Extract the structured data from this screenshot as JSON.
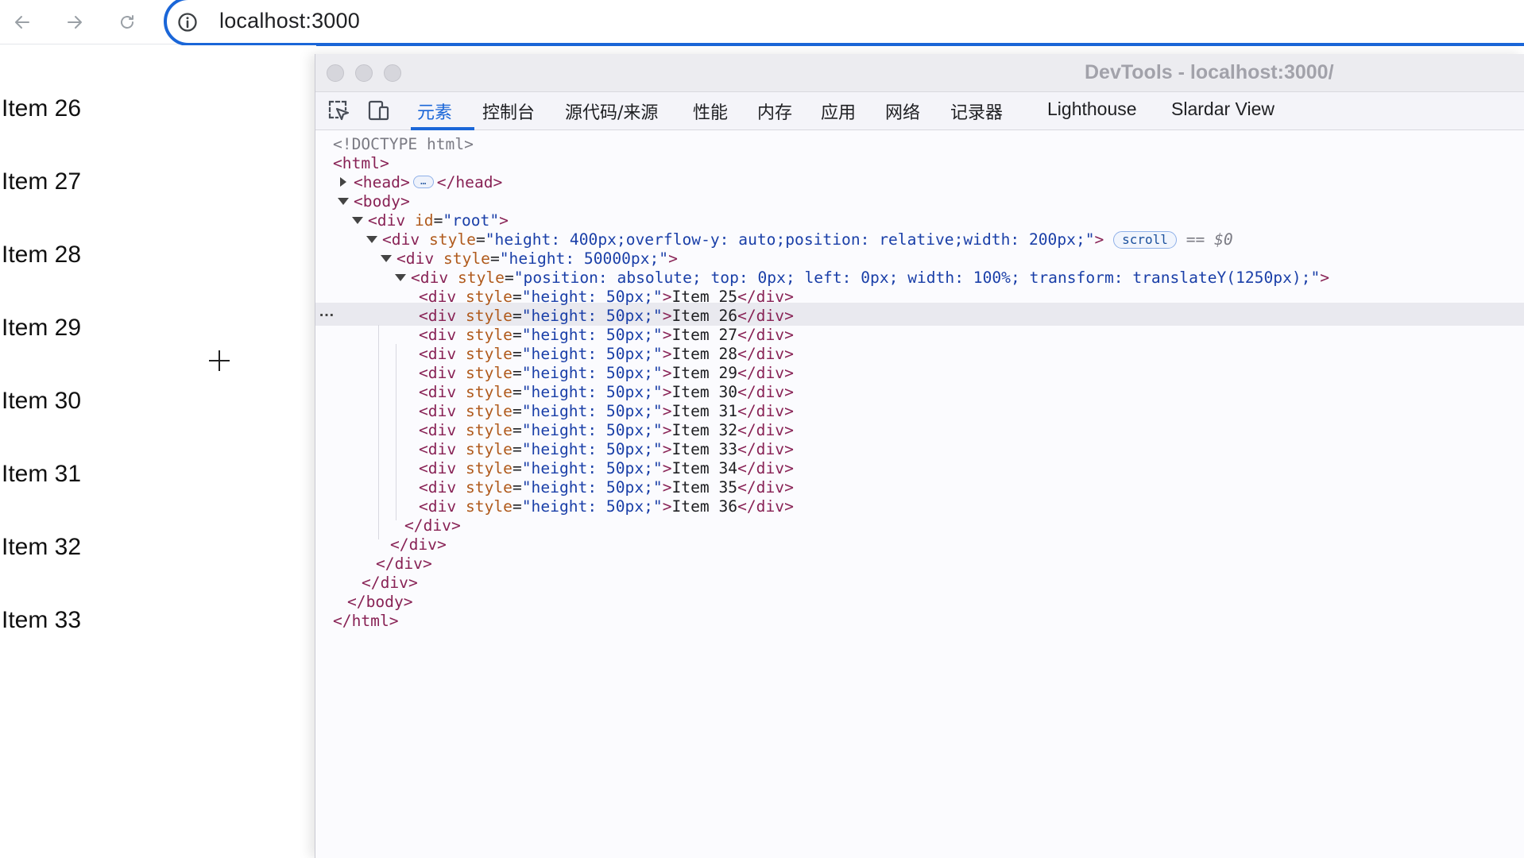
{
  "browser": {
    "url": "localhost:3000",
    "back_icon": "arrow-left-icon",
    "forward_icon": "arrow-right-icon",
    "reload_icon": "reload-icon",
    "site_info_icon": "info-circle-icon"
  },
  "page": {
    "items": [
      "Item 26",
      "Item 27",
      "Item 28",
      "Item 29",
      "Item 30",
      "Item 31",
      "Item 32",
      "Item 33"
    ]
  },
  "devtools": {
    "title": "DevTools - localhost:3000/",
    "tools": {
      "inspect_icon": "inspect-element-icon",
      "device_icon": "device-toolbar-icon"
    },
    "tabs": [
      "元素",
      "控制台",
      "源代码/来源",
      "性能",
      "内存",
      "应用",
      "网络",
      "记录器",
      "Lighthouse",
      "Slardar View"
    ],
    "active_tab": "元素",
    "accent_color": "#1a66d8",
    "tree": {
      "doctype": "<!DOCTYPE html>",
      "html_open": "<html>",
      "head_open": "<head>",
      "head_close": "</head>",
      "head_ellipsis": "…",
      "body_open": "<body>",
      "root_div": {
        "open": "<div",
        "attr": "id",
        "eq": "=",
        "value": "\"root\"",
        "close": ">"
      },
      "scroll_div": {
        "open": "<div",
        "attr": "style",
        "eq": "=",
        "value": "\"height: 400px;overflow-y: auto;position: relative;width: 200px;\"",
        "close": ">",
        "badge": "scroll",
        "eq_selected": "==",
        "dollar": "$0",
        "row_dots": "…"
      },
      "height_div": {
        "open": "<div",
        "attr": "style",
        "eq": "=",
        "value": "\"height: 50000px;\"",
        "close": ">"
      },
      "abs_div": {
        "open": "<div",
        "attr": "style",
        "eq": "=",
        "value": "\"position: absolute; top: 0px; left: 0px; width: 100%; transform: translateY(1250px);\"",
        "close": ">"
      },
      "child_rows": [
        {
          "open": "<div",
          "attr": "style",
          "eq": "=",
          "value": "\"height: 50px;\"",
          "gt": ">",
          "text": "Item 25",
          "close": "</div>"
        },
        {
          "open": "<div",
          "attr": "style",
          "eq": "=",
          "value": "\"height: 50px;\"",
          "gt": ">",
          "text": "Item 26",
          "close": "</div>"
        },
        {
          "open": "<div",
          "attr": "style",
          "eq": "=",
          "value": "\"height: 50px;\"",
          "gt": ">",
          "text": "Item 27",
          "close": "</div>"
        },
        {
          "open": "<div",
          "attr": "style",
          "eq": "=",
          "value": "\"height: 50px;\"",
          "gt": ">",
          "text": "Item 28",
          "close": "</div>"
        },
        {
          "open": "<div",
          "attr": "style",
          "eq": "=",
          "value": "\"height: 50px;\"",
          "gt": ">",
          "text": "Item 29",
          "close": "</div>"
        },
        {
          "open": "<div",
          "attr": "style",
          "eq": "=",
          "value": "\"height: 50px;\"",
          "gt": ">",
          "text": "Item 30",
          "close": "</div>"
        },
        {
          "open": "<div",
          "attr": "style",
          "eq": "=",
          "value": "\"height: 50px;\"",
          "gt": ">",
          "text": "Item 31",
          "close": "</div>"
        },
        {
          "open": "<div",
          "attr": "style",
          "eq": "=",
          "value": "\"height: 50px;\"",
          "gt": ">",
          "text": "Item 32",
          "close": "</div>"
        },
        {
          "open": "<div",
          "attr": "style",
          "eq": "=",
          "value": "\"height: 50px;\"",
          "gt": ">",
          "text": "Item 33",
          "close": "</div>"
        },
        {
          "open": "<div",
          "attr": "style",
          "eq": "=",
          "value": "\"height: 50px;\"",
          "gt": ">",
          "text": "Item 34",
          "close": "</div>"
        },
        {
          "open": "<div",
          "attr": "style",
          "eq": "=",
          "value": "\"height: 50px;\"",
          "gt": ">",
          "text": "Item 35",
          "close": "</div>"
        },
        {
          "open": "<div",
          "attr": "style",
          "eq": "=",
          "value": "\"height: 50px;\"",
          "gt": ">",
          "text": "Item 36",
          "close": "</div>"
        }
      ],
      "div_close": "</div>",
      "body_close": "</body>",
      "html_close": "</html>"
    }
  }
}
